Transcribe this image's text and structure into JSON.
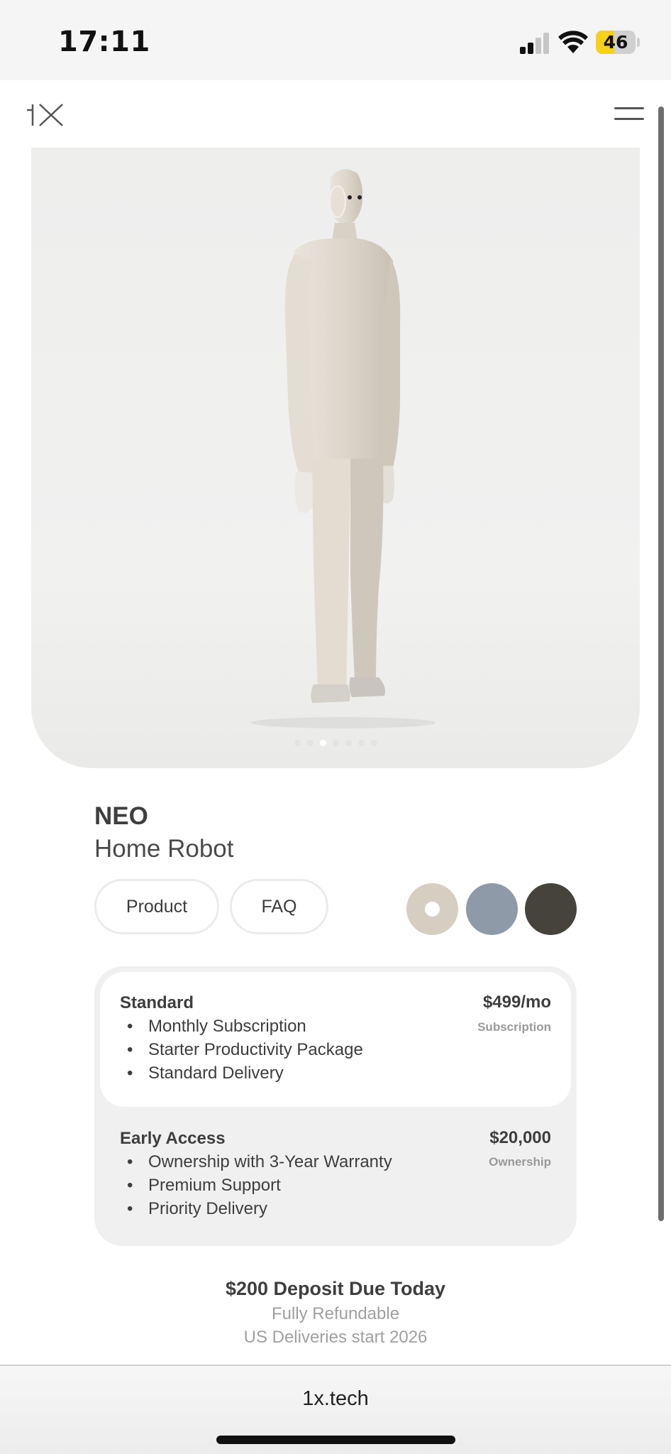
{
  "status_bar": {
    "time": "17:11",
    "battery_level": "46",
    "battery_fraction": 0.46,
    "icons": [
      "signal-icon",
      "wifi-icon",
      "battery-icon"
    ]
  },
  "header": {
    "logo_icon": "1x-logo",
    "menu_icon": "hamburger-menu-icon"
  },
  "hero": {
    "image": "robot-product-image",
    "carousel_total": 7,
    "carousel_active_index": 2
  },
  "product": {
    "name": "NEO",
    "tagline": "Home Robot",
    "tabs": [
      {
        "label": "Product"
      },
      {
        "label": "FAQ"
      }
    ],
    "colors": [
      {
        "name": "beige",
        "hex": "#d7cec2",
        "selected": true
      },
      {
        "name": "blue-grey",
        "hex": "#8e9aa8",
        "selected": false
      },
      {
        "name": "dark",
        "hex": "#46433d",
        "selected": false
      }
    ]
  },
  "plans": [
    {
      "name": "Standard",
      "price": "$499/mo",
      "note": "Subscription",
      "features": [
        "Monthly Subscription",
        "Starter Productivity Package",
        "Standard Delivery"
      ],
      "selected": true
    },
    {
      "name": "Early Access",
      "price": "$20,000",
      "note": "Ownership",
      "features": [
        "Ownership with 3-Year Warranty",
        "Premium Support",
        "Priority Delivery"
      ],
      "selected": false
    }
  ],
  "deposit": {
    "headline": "$200 Deposit Due Today",
    "line1": "Fully Refundable",
    "line2": "US Deliveries start 2026"
  },
  "browser": {
    "url": "1x.tech"
  }
}
